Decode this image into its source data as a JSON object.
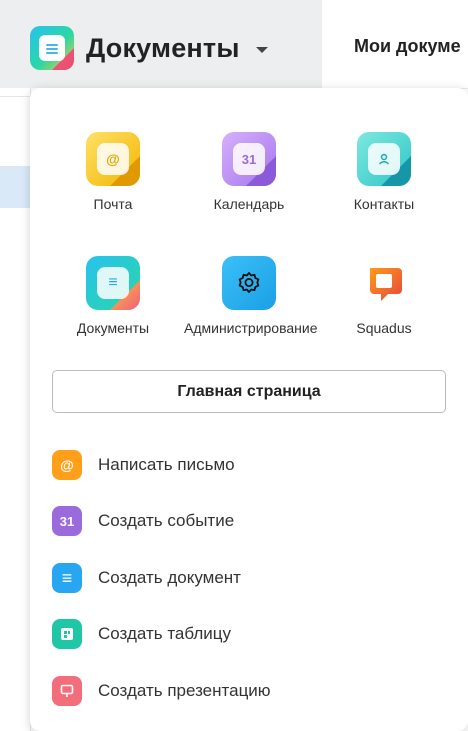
{
  "header": {
    "app_name": "Документы",
    "page_title": "Мои докуме"
  },
  "launcher": {
    "apps": [
      {
        "label": "Почта",
        "glyph": "@",
        "icon": "mail-icon",
        "colors": [
          "#ffd54a",
          "#e0a400"
        ]
      },
      {
        "label": "Календарь",
        "glyph": "31",
        "icon": "calendar-icon",
        "colors": [
          "#c39cf5",
          "#8a5ad9"
        ]
      },
      {
        "label": "Контакты",
        "glyph": "👤",
        "icon": "contacts-icon",
        "colors": [
          "#66e0d7",
          "#1ba7b2"
        ]
      },
      {
        "label": "Документы",
        "glyph": "≡",
        "icon": "documents-icon",
        "colors": [
          "#29c3ef",
          "#f55c78"
        ]
      },
      {
        "label": "Администрирование",
        "glyph": "⚙",
        "icon": "settings-icon",
        "colors": [
          "#30b6f5",
          "#1a9fe6"
        ]
      },
      {
        "label": "Squadus",
        "glyph": "",
        "icon": "squadus-icon",
        "colors": [
          "#ff8a1a",
          "#e6473c"
        ]
      }
    ],
    "home_button": "Главная страница",
    "actions": [
      {
        "label": "Написать письмо",
        "glyph": "@",
        "icon": "write-mail-icon",
        "color": "#ff9f1a"
      },
      {
        "label": "Создать событие",
        "glyph": "31",
        "icon": "create-event-icon",
        "color": "#9b6bde"
      },
      {
        "label": "Создать документ",
        "glyph": "≡",
        "icon": "create-document-icon",
        "color": "#29a6f2"
      },
      {
        "label": "Создать таблицу",
        "glyph": "▦",
        "icon": "create-table-icon",
        "color": "#1fc7a6"
      },
      {
        "label": "Создать презентацию",
        "glyph": "▭",
        "icon": "create-presentation-icon",
        "color": "#f26e7b"
      }
    ]
  }
}
